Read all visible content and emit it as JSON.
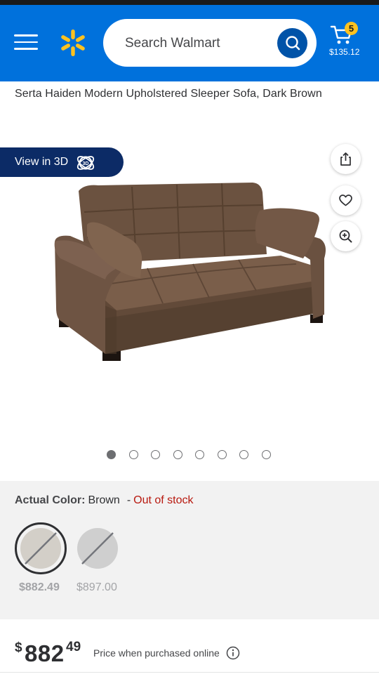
{
  "header": {
    "search_placeholder": "Search Walmart",
    "cart_count": "5",
    "cart_total": "$135.12",
    "brand_color": "#0071dc",
    "spark_color": "#ffc220"
  },
  "product": {
    "title": "Serta Haiden Modern Upholstered Sleeper Sofa, Dark Brown",
    "view_3d_label": "View in 3D",
    "image_count": 8,
    "active_image_index": 0
  },
  "icons": {
    "menu": "hamburger-menu-icon",
    "logo": "walmart-spark-icon",
    "search": "search-icon",
    "cart": "cart-icon",
    "view3d": "3d-cube-icon",
    "share": "share-icon",
    "favorite": "heart-icon",
    "zoom": "zoom-in-icon",
    "info": "info-icon"
  },
  "color_options": {
    "label": "Actual Color:",
    "selected_value": "Brown",
    "separator": "-",
    "stock_status": "Out of stock",
    "swatches": [
      {
        "name": "Brown",
        "price": "$882.49",
        "selected": true
      },
      {
        "name": "Gray",
        "price": "$897.00",
        "selected": false
      }
    ]
  },
  "price": {
    "currency_symbol": "$",
    "dollars": "882",
    "cents": "49",
    "note": "Price when purchased online"
  }
}
